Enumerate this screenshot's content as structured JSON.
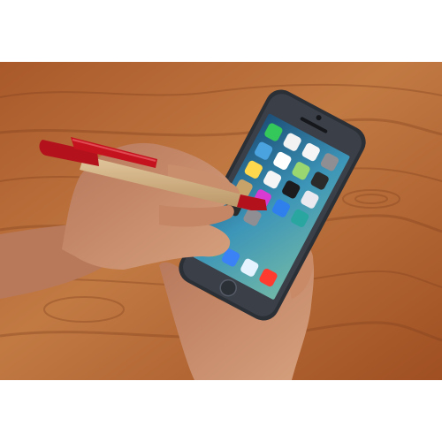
{
  "scene": {
    "background_color": "#ffffff",
    "table_color": "#b5652e",
    "phone_color": "#2b2f36",
    "screen_color": "#3e8fb3",
    "pen_barrel_color": "#cfae82",
    "pen_cap_color": "#b3121d",
    "skin_color": "#c48a66"
  },
  "phone_screen": {
    "app_icons": [
      {
        "icon": "messages-icon",
        "color": "#34c759"
      },
      {
        "icon": "calendar-icon",
        "color": "#f2f2f2"
      },
      {
        "icon": "photos-icon",
        "color": "#f5f5f5"
      },
      {
        "icon": "camera-icon",
        "color": "#8e8e93"
      },
      {
        "icon": "weather-icon",
        "color": "#4aa3df"
      },
      {
        "icon": "clock-icon",
        "color": "#ffffff"
      },
      {
        "icon": "maps-icon",
        "color": "#9bd770"
      },
      {
        "icon": "videos-icon",
        "color": "#2b2b2b"
      },
      {
        "icon": "notes-icon",
        "color": "#ffd84d"
      },
      {
        "icon": "reminders-icon",
        "color": "#f5f5f5"
      },
      {
        "icon": "stocks-icon",
        "color": "#1c1c1e"
      },
      {
        "icon": "game-center-icon",
        "color": "#e9e9ef"
      },
      {
        "icon": "newsstand-icon",
        "color": "#c7a36a"
      },
      {
        "icon": "itunes-store-icon",
        "color": "#d83bd2"
      },
      {
        "icon": "app-store-icon",
        "color": "#2f80ed"
      },
      {
        "icon": "passbook-icon",
        "color": "#2aa6a0"
      },
      {
        "icon": "compass-icon",
        "color": "#2b2b2b"
      },
      {
        "icon": "settings-icon",
        "color": "#8e8e93"
      },
      {
        "icon": "phone-icon",
        "color": "#34c759"
      },
      {
        "icon": "mail-icon",
        "color": "#3b82f6"
      },
      {
        "icon": "safari-icon",
        "color": "#e5f2ff"
      },
      {
        "icon": "music-icon",
        "color": "#ff3b30"
      }
    ]
  }
}
